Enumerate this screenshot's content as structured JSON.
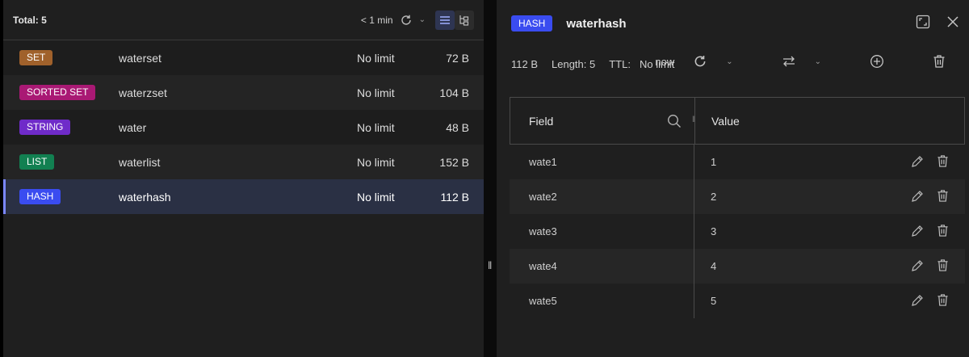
{
  "key_list": {
    "total_label": "Total: 5",
    "last_refresh": "< 1 min",
    "keys": [
      {
        "type": "SET",
        "type_color": "#a0612b",
        "name": "waterset",
        "ttl": "No limit",
        "size": "72 B"
      },
      {
        "type": "SORTED SET",
        "type_color": "#a91974",
        "name": "waterzset",
        "ttl": "No limit",
        "size": "104 B"
      },
      {
        "type": "STRING",
        "type_color": "#6f2bc9",
        "name": "water",
        "ttl": "No limit",
        "size": "48 B"
      },
      {
        "type": "LIST",
        "type_color": "#128051",
        "name": "waterlist",
        "ttl": "No limit",
        "size": "152 B"
      },
      {
        "type": "HASH",
        "type_color": "#3a4cf0",
        "name": "waterhash",
        "ttl": "No limit",
        "size": "112 B"
      }
    ]
  },
  "details": {
    "type": "HASH",
    "key_name": "waterhash",
    "size": "112 B",
    "length_label": "Length: 5",
    "ttl_label": "TTL:",
    "ttl_value": "No limit",
    "refresh_label": "now",
    "table": {
      "field_header": "Field",
      "value_header": "Value",
      "rows": [
        {
          "field": "wate1",
          "value": "1"
        },
        {
          "field": "wate2",
          "value": "2"
        },
        {
          "field": "wate3",
          "value": "3"
        },
        {
          "field": "wate4",
          "value": "4"
        },
        {
          "field": "wate5",
          "value": "5"
        }
      ]
    }
  },
  "icons": [
    "refresh-icon",
    "chevron-down-icon",
    "list-view-icon",
    "tree-view-icon",
    "fullscreen-icon",
    "close-icon",
    "format-switch-icon",
    "add-icon",
    "delete-icon",
    "search-icon",
    "edit-icon",
    "resize-handle-icon"
  ]
}
